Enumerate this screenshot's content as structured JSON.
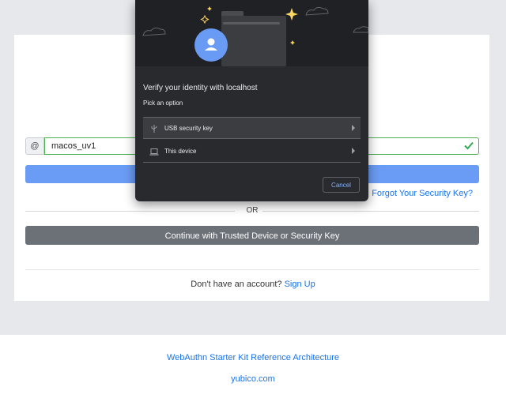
{
  "form": {
    "at_symbol": "@",
    "username_value": "macos_uv1",
    "forgot_link": "Forgot Your Security Key?",
    "or_text": "OR",
    "continue_button": "Continue with Trusted Device or Security Key",
    "signup_prompt": "Don't have an account?",
    "signup_link": "Sign Up"
  },
  "footer": {
    "reference_link": "WebAuthn Starter Kit Reference Architecture",
    "site_link": "yubico.com"
  },
  "dialog": {
    "title": "Verify your identity with localhost",
    "subtitle": "Pick an option",
    "options": [
      {
        "label": "USB security key",
        "icon": "usb-icon"
      },
      {
        "label": "This device",
        "icon": "laptop-icon"
      }
    ],
    "cancel_label": "Cancel"
  },
  "colors": {
    "accent_blue": "#6b9cf5",
    "link_blue": "#1a73e8",
    "success_green": "#4caf50",
    "dialog_bg": "#292a2d",
    "dialog_link": "#8ab4f8"
  }
}
